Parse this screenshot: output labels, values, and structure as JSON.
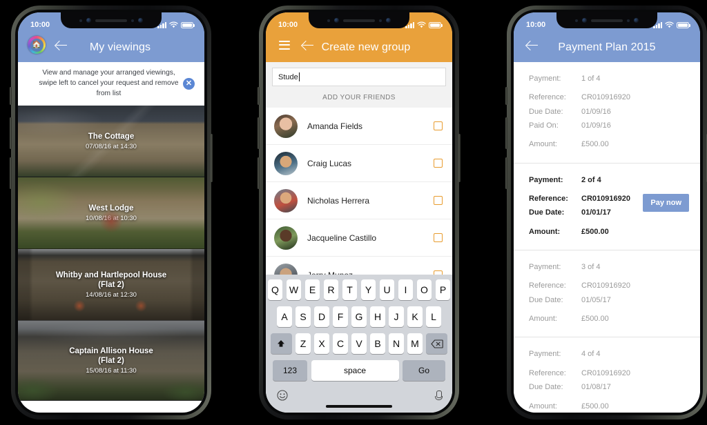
{
  "meta": {
    "colors": {
      "blue_header": "#7d9bd1",
      "orange_header": "#e9a13b",
      "checkbox_orange": "#e89c2e",
      "pay_button_blue": "#7d9bd1",
      "page_background": "#000000"
    }
  },
  "phone1": {
    "status": {
      "time": "10:00",
      "signal_icon": "signal-bars-icon",
      "wifi_icon": "wifi-icon",
      "battery_icon": "battery-icon"
    },
    "nav": {
      "logo_icon": "app-logo-icon",
      "back_icon": "back-arrow-icon",
      "title": "My viewings"
    },
    "banner": {
      "text": "View and manage your arranged viewings, swipe left to cancel your request and remove from list",
      "close_icon": "close-circle-icon",
      "close_label": "✕"
    },
    "listings": [
      {
        "title": "The Cottage",
        "subtitle": "07/08/16 at 14:30"
      },
      {
        "title": "West Lodge",
        "subtitle": "10/08/16 at 10:30"
      },
      {
        "title": "Whitby and Hartlepool House",
        "title_line2": "(Flat 2)",
        "subtitle": "14/08/16 at 12:30"
      },
      {
        "title": "Captain Allison House",
        "title_line2": "(Flat 2)",
        "subtitle": "15/08/16 at 11:30"
      }
    ]
  },
  "phone2": {
    "status": {
      "time": "10:00",
      "signal_icon": "signal-bars-icon",
      "wifi_icon": "wifi-icon",
      "battery_icon": "battery-icon"
    },
    "nav": {
      "menu_icon": "hamburger-menu-icon",
      "back_icon": "back-arrow-icon",
      "title": "Create new group"
    },
    "search": {
      "value": "Stude",
      "placeholder": ""
    },
    "section_label": "ADD YOUR FRIENDS",
    "contacts": [
      {
        "name": "Amanda Fields",
        "checked": false
      },
      {
        "name": "Craig Lucas",
        "checked": false
      },
      {
        "name": "Nicholas Herrera",
        "checked": false
      },
      {
        "name": "Jacqueline Castillo",
        "checked": false
      },
      {
        "name": "Jerry Munoz",
        "checked": false
      }
    ],
    "keyboard": {
      "row1": [
        "Q",
        "W",
        "E",
        "R",
        "T",
        "Y",
        "U",
        "I",
        "O",
        "P"
      ],
      "row2": [
        "A",
        "S",
        "D",
        "F",
        "G",
        "H",
        "J",
        "K",
        "L"
      ],
      "row3": [
        "Z",
        "X",
        "C",
        "V",
        "B",
        "N",
        "M"
      ],
      "shift_icon": "shift-up-arrow-icon",
      "shift_label": "⬆",
      "backspace_icon": "backspace-icon",
      "backspace_label": "⌫",
      "numbers_label": "123",
      "space_label": "space",
      "go_label": "Go",
      "emoji_icon": "emoji-face-icon",
      "emoji_label": "☺",
      "mic_icon": "microphone-icon"
    }
  },
  "phone3": {
    "status": {
      "time": "10:00",
      "signal_icon": "signal-bars-icon",
      "wifi_icon": "wifi-icon",
      "battery_icon": "battery-icon"
    },
    "nav": {
      "back_icon": "back-arrow-icon",
      "title": "Payment Plan 2015"
    },
    "labels": {
      "payment": "Payment:",
      "reference": "Reference:",
      "due_date": "Due Date:",
      "paid_on": "Paid On:",
      "amount": "Amount:"
    },
    "pay_button_label": "Pay now",
    "payments": [
      {
        "payment": "1 of 4",
        "reference": "CR010916920",
        "due_date": "01/09/16",
        "paid_on": "01/09/16",
        "amount": "£500.00",
        "state": "paid"
      },
      {
        "payment": "2 of 4",
        "reference": "CR010916920",
        "due_date": "01/01/17",
        "paid_on": null,
        "amount": "£500.00",
        "state": "due"
      },
      {
        "payment": "3 of 4",
        "reference": "CR010916920",
        "due_date": "01/05/17",
        "paid_on": null,
        "amount": "£500.00",
        "state": "upcoming"
      },
      {
        "payment": "4 of 4",
        "reference": "CR010916920",
        "due_date": "01/08/17",
        "paid_on": null,
        "amount": "£500.00",
        "state": "upcoming"
      }
    ]
  }
}
